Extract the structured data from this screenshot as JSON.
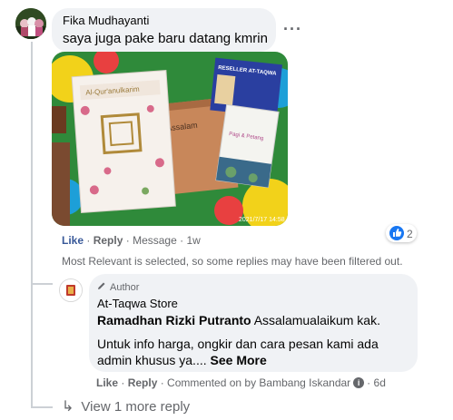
{
  "comment": {
    "author": "Fika Mudhayanti",
    "text": "saya juga pake baru datang kmrin",
    "more_icon": "ellipsis-icon",
    "actions": {
      "like": "Like",
      "reply": "Reply",
      "message": "Message",
      "time": "1w"
    },
    "reaction_count": "2",
    "photo": {
      "book_title": "Al-Qur'anulkarim",
      "box_text": "Assalam",
      "card_brand": "RESELLER AT-TAQWA",
      "small_book_title": "Pagi & Petang",
      "timestamp": "2021/7/17 14:58"
    }
  },
  "filter_note": "Most Relevant is selected, so some replies may have been filtered out.",
  "reply": {
    "badge_icon": "pencil-icon",
    "badge_label": "Author",
    "author": "At-Taqwa Store",
    "mention": "Ramadhan Rizki Putranto",
    "line1_rest": " Assalamualaikum kak.",
    "line2": "Untuk info harga, ongkir dan cara pesan kami ada",
    "line3": "admin khusus ya....",
    "see_more": "See More",
    "actions": {
      "like": "Like",
      "reply": "Reply",
      "commented_by": "Commented on by Bambang Iskandar",
      "time": "6d"
    }
  },
  "view_more": "View 1 more reply",
  "colors": {
    "bubble_bg": "#f0f2f5",
    "link_blue": "#385898",
    "like_blue": "#1877f2",
    "meta_gray": "#65676b"
  }
}
